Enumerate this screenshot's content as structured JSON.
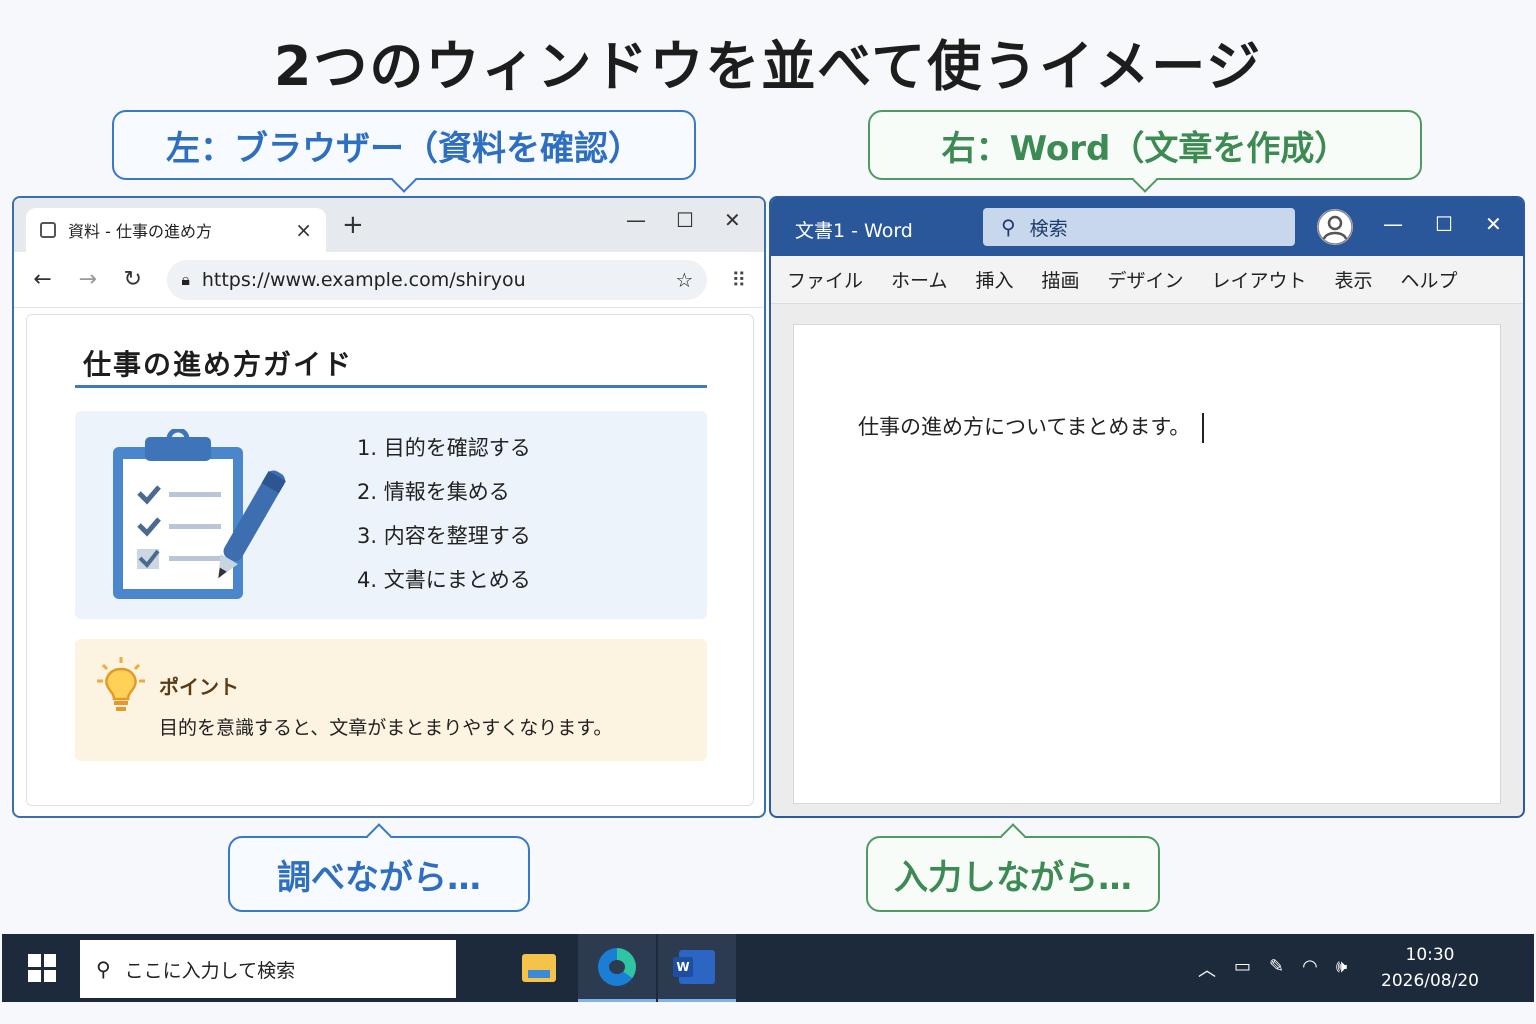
{
  "title": "2つのウィンドウを並べて使うイメージ",
  "callouts": {
    "top_left": "左：ブラウザー（資料を確認）",
    "top_right": "右：Word（文章を作成）",
    "bottom_left": "調べながら…",
    "bottom_right": "入力しながら…"
  },
  "browser": {
    "tab_title": "資料 - 仕事の進め方",
    "tab_close": "×",
    "new_tab": "+",
    "url": "https://www.example.com/shiryou",
    "page": {
      "heading": "仕事の進め方ガイド",
      "steps": [
        "1.  目的を確認する",
        "2.  情報を集める",
        "3.  内容を整理する",
        "4.  文書にまとめる"
      ],
      "tip_label": "ポイント",
      "tip_text": "目的を意識すると、文章がまとまりやすくなります。"
    }
  },
  "word": {
    "title": "文書1  -  Word",
    "search_placeholder": "検索",
    "menu": [
      "ファイル",
      "ホーム",
      "挿入",
      "描画",
      "デザイン",
      "レイアウト",
      "表示",
      "ヘルプ"
    ],
    "document_text": "仕事の進め方についてまとめます。"
  },
  "taskbar": {
    "search_placeholder": "ここに入力して検索",
    "time": "10:30",
    "date": "2026/08/20",
    "apps": [
      "file-explorer-icon",
      "edge-icon",
      "word-icon"
    ]
  },
  "colors": {
    "blue_accent": "#3a78c9",
    "green_accent": "#4f9a63",
    "word_blue": "#2a579a",
    "taskbar": "#1d2a3b",
    "tip_bg": "#fdf3e1",
    "steps_bg": "#edf3fb"
  }
}
